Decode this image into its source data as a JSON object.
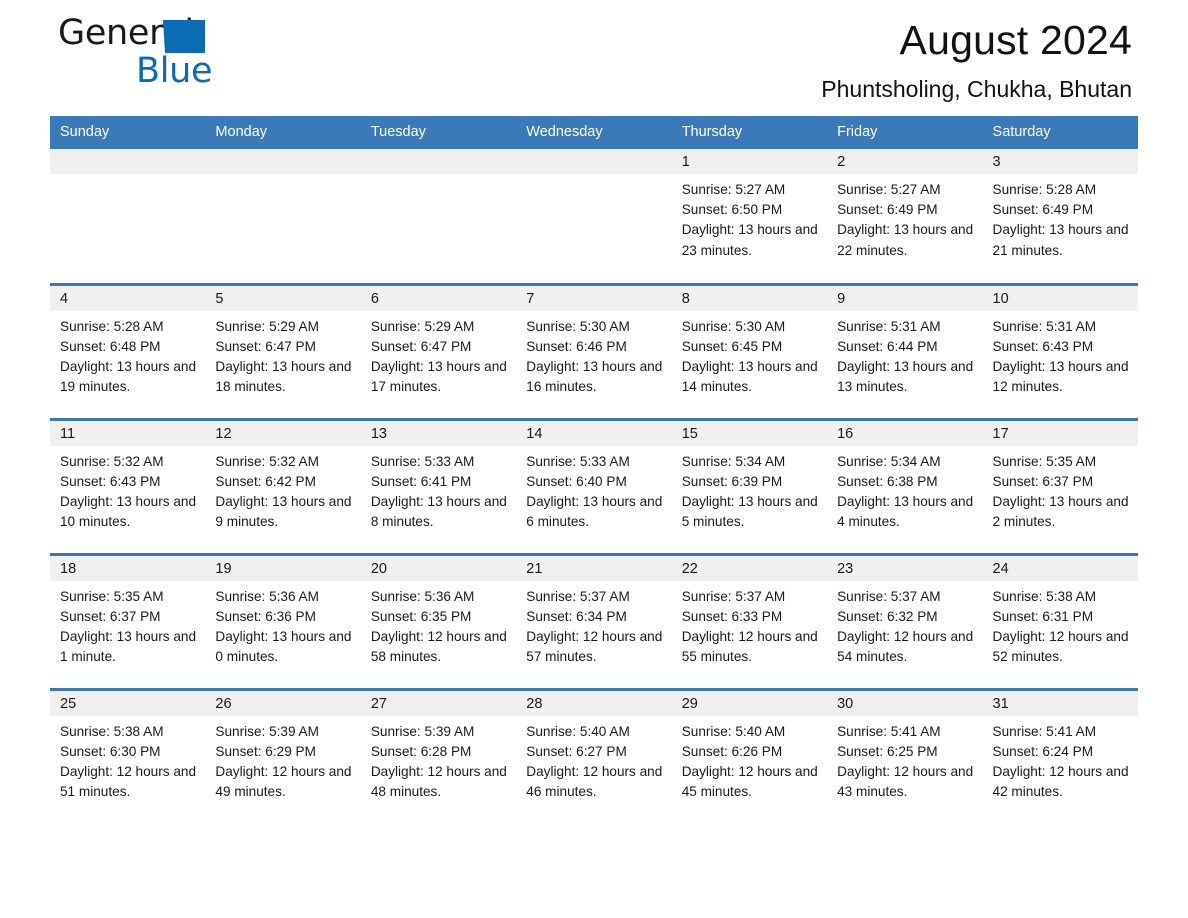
{
  "brand": {
    "name_part1": "General",
    "name_part2": "Blue",
    "triangle_icon": "triangle-logo-icon",
    "accent_color": "#0b6bb5"
  },
  "header": {
    "title": "August 2024",
    "subtitle": "Phuntsholing, Chukha, Bhutan"
  },
  "colors": {
    "header_blue": "#3a7ab8",
    "day_band_gray": "#f0f0f0",
    "text": "#1a1a1a"
  },
  "weekdays": [
    "Sunday",
    "Monday",
    "Tuesday",
    "Wednesday",
    "Thursday",
    "Friday",
    "Saturday"
  ],
  "weeks": [
    [
      {
        "day": "",
        "empty": true
      },
      {
        "day": "",
        "empty": true
      },
      {
        "day": "",
        "empty": true
      },
      {
        "day": "",
        "empty": true
      },
      {
        "day": "1",
        "sunrise": "Sunrise: 5:27 AM",
        "sunset": "Sunset: 6:50 PM",
        "daylight": "Daylight: 13 hours and 23 minutes."
      },
      {
        "day": "2",
        "sunrise": "Sunrise: 5:27 AM",
        "sunset": "Sunset: 6:49 PM",
        "daylight": "Daylight: 13 hours and 22 minutes."
      },
      {
        "day": "3",
        "sunrise": "Sunrise: 5:28 AM",
        "sunset": "Sunset: 6:49 PM",
        "daylight": "Daylight: 13 hours and 21 minutes."
      }
    ],
    [
      {
        "day": "4",
        "sunrise": "Sunrise: 5:28 AM",
        "sunset": "Sunset: 6:48 PM",
        "daylight": "Daylight: 13 hours and 19 minutes."
      },
      {
        "day": "5",
        "sunrise": "Sunrise: 5:29 AM",
        "sunset": "Sunset: 6:47 PM",
        "daylight": "Daylight: 13 hours and 18 minutes."
      },
      {
        "day": "6",
        "sunrise": "Sunrise: 5:29 AM",
        "sunset": "Sunset: 6:47 PM",
        "daylight": "Daylight: 13 hours and 17 minutes."
      },
      {
        "day": "7",
        "sunrise": "Sunrise: 5:30 AM",
        "sunset": "Sunset: 6:46 PM",
        "daylight": "Daylight: 13 hours and 16 minutes."
      },
      {
        "day": "8",
        "sunrise": "Sunrise: 5:30 AM",
        "sunset": "Sunset: 6:45 PM",
        "daylight": "Daylight: 13 hours and 14 minutes."
      },
      {
        "day": "9",
        "sunrise": "Sunrise: 5:31 AM",
        "sunset": "Sunset: 6:44 PM",
        "daylight": "Daylight: 13 hours and 13 minutes."
      },
      {
        "day": "10",
        "sunrise": "Sunrise: 5:31 AM",
        "sunset": "Sunset: 6:43 PM",
        "daylight": "Daylight: 13 hours and 12 minutes."
      }
    ],
    [
      {
        "day": "11",
        "sunrise": "Sunrise: 5:32 AM",
        "sunset": "Sunset: 6:43 PM",
        "daylight": "Daylight: 13 hours and 10 minutes."
      },
      {
        "day": "12",
        "sunrise": "Sunrise: 5:32 AM",
        "sunset": "Sunset: 6:42 PM",
        "daylight": "Daylight: 13 hours and 9 minutes."
      },
      {
        "day": "13",
        "sunrise": "Sunrise: 5:33 AM",
        "sunset": "Sunset: 6:41 PM",
        "daylight": "Daylight: 13 hours and 8 minutes."
      },
      {
        "day": "14",
        "sunrise": "Sunrise: 5:33 AM",
        "sunset": "Sunset: 6:40 PM",
        "daylight": "Daylight: 13 hours and 6 minutes."
      },
      {
        "day": "15",
        "sunrise": "Sunrise: 5:34 AM",
        "sunset": "Sunset: 6:39 PM",
        "daylight": "Daylight: 13 hours and 5 minutes."
      },
      {
        "day": "16",
        "sunrise": "Sunrise: 5:34 AM",
        "sunset": "Sunset: 6:38 PM",
        "daylight": "Daylight: 13 hours and 4 minutes."
      },
      {
        "day": "17",
        "sunrise": "Sunrise: 5:35 AM",
        "sunset": "Sunset: 6:37 PM",
        "daylight": "Daylight: 13 hours and 2 minutes."
      }
    ],
    [
      {
        "day": "18",
        "sunrise": "Sunrise: 5:35 AM",
        "sunset": "Sunset: 6:37 PM",
        "daylight": "Daylight: 13 hours and 1 minute."
      },
      {
        "day": "19",
        "sunrise": "Sunrise: 5:36 AM",
        "sunset": "Sunset: 6:36 PM",
        "daylight": "Daylight: 13 hours and 0 minutes."
      },
      {
        "day": "20",
        "sunrise": "Sunrise: 5:36 AM",
        "sunset": "Sunset: 6:35 PM",
        "daylight": "Daylight: 12 hours and 58 minutes."
      },
      {
        "day": "21",
        "sunrise": "Sunrise: 5:37 AM",
        "sunset": "Sunset: 6:34 PM",
        "daylight": "Daylight: 12 hours and 57 minutes."
      },
      {
        "day": "22",
        "sunrise": "Sunrise: 5:37 AM",
        "sunset": "Sunset: 6:33 PM",
        "daylight": "Daylight: 12 hours and 55 minutes."
      },
      {
        "day": "23",
        "sunrise": "Sunrise: 5:37 AM",
        "sunset": "Sunset: 6:32 PM",
        "daylight": "Daylight: 12 hours and 54 minutes."
      },
      {
        "day": "24",
        "sunrise": "Sunrise: 5:38 AM",
        "sunset": "Sunset: 6:31 PM",
        "daylight": "Daylight: 12 hours and 52 minutes."
      }
    ],
    [
      {
        "day": "25",
        "sunrise": "Sunrise: 5:38 AM",
        "sunset": "Sunset: 6:30 PM",
        "daylight": "Daylight: 12 hours and 51 minutes."
      },
      {
        "day": "26",
        "sunrise": "Sunrise: 5:39 AM",
        "sunset": "Sunset: 6:29 PM",
        "daylight": "Daylight: 12 hours and 49 minutes."
      },
      {
        "day": "27",
        "sunrise": "Sunrise: 5:39 AM",
        "sunset": "Sunset: 6:28 PM",
        "daylight": "Daylight: 12 hours and 48 minutes."
      },
      {
        "day": "28",
        "sunrise": "Sunrise: 5:40 AM",
        "sunset": "Sunset: 6:27 PM",
        "daylight": "Daylight: 12 hours and 46 minutes."
      },
      {
        "day": "29",
        "sunrise": "Sunrise: 5:40 AM",
        "sunset": "Sunset: 6:26 PM",
        "daylight": "Daylight: 12 hours and 45 minutes."
      },
      {
        "day": "30",
        "sunrise": "Sunrise: 5:41 AM",
        "sunset": "Sunset: 6:25 PM",
        "daylight": "Daylight: 12 hours and 43 minutes."
      },
      {
        "day": "31",
        "sunrise": "Sunrise: 5:41 AM",
        "sunset": "Sunset: 6:24 PM",
        "daylight": "Daylight: 12 hours and 42 minutes."
      }
    ]
  ]
}
